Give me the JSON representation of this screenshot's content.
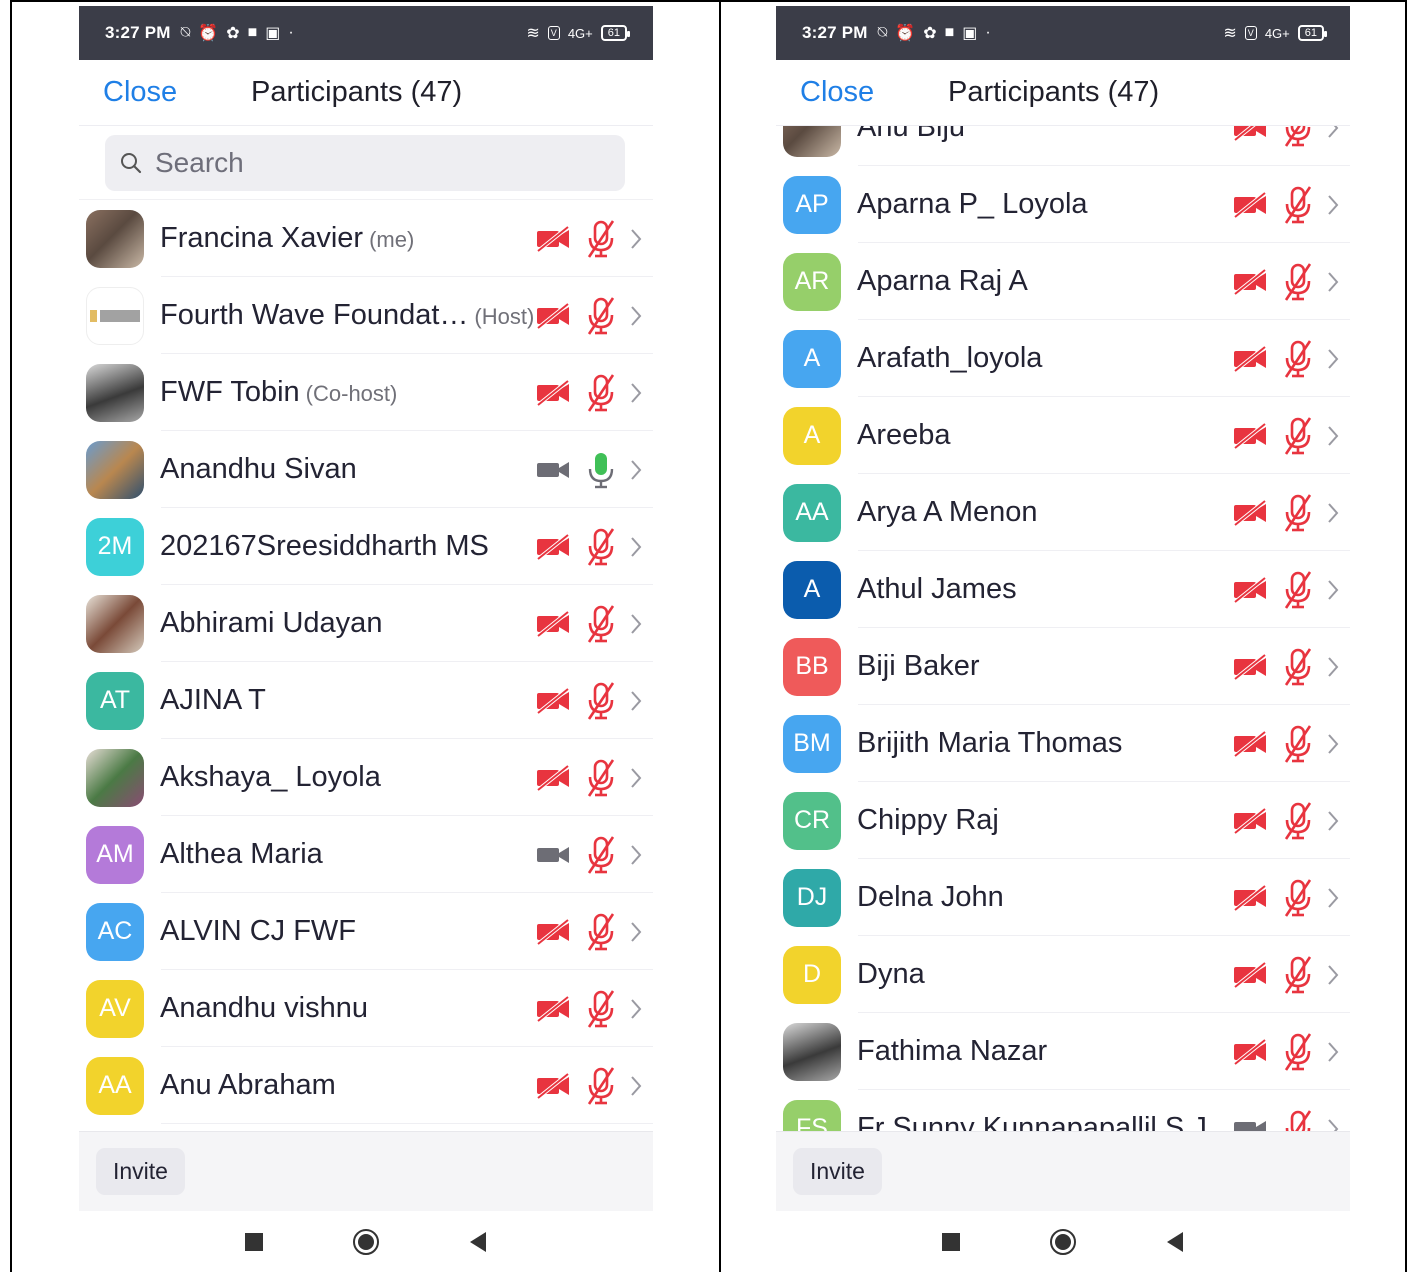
{
  "status_bar": {
    "time": "3:27 PM",
    "battery": "61",
    "network": "4G+"
  },
  "colors": {
    "accent_blue": "#1f7fe6",
    "muted_red": "#e8343f",
    "unmuted_green": "#40c057",
    "status_bar_bg": "#3b3d48"
  },
  "header": {
    "close_label": "Close",
    "title": "Participants (47)"
  },
  "search": {
    "placeholder": "Search"
  },
  "footer": {
    "invite_label": "Invite"
  },
  "screen_left": {
    "participants": [
      {
        "name": "Francina Xavier",
        "role": "(me)",
        "avatar": "photo",
        "video": "off",
        "audio": "muted"
      },
      {
        "name": "Fourth Wave Foundat…",
        "role": "(Host)",
        "avatar": "logo",
        "video": "off",
        "audio": "muted"
      },
      {
        "name": "FWF Tobin",
        "role": "(Co-host)",
        "avatar": "photo",
        "video": "off",
        "audio": "muted"
      },
      {
        "name": "Anandhu Sivan",
        "role": "",
        "avatar": "photo",
        "video": "on",
        "audio": "unmuted"
      },
      {
        "name": "202167Sreesiddharth MS",
        "role": "",
        "initials": "2M",
        "avatar_color": "#3dd0d8",
        "video": "off",
        "audio": "muted"
      },
      {
        "name": "Abhirami Udayan",
        "role": "",
        "avatar": "photo",
        "video": "off",
        "audio": "muted"
      },
      {
        "name": "AJINA T",
        "role": "",
        "initials": "AT",
        "avatar_color": "#3bb8a0",
        "video": "off",
        "audio": "muted"
      },
      {
        "name": "Akshaya_ Loyola",
        "role": "",
        "avatar": "photo",
        "video": "off",
        "audio": "muted"
      },
      {
        "name": "Althea Maria",
        "role": "",
        "initials": "AM",
        "avatar_color": "#b47ad9",
        "video": "on",
        "audio": "muted"
      },
      {
        "name": "ALVIN CJ FWF",
        "role": "",
        "initials": "AC",
        "avatar_color": "#47a6f0",
        "video": "off",
        "audio": "muted"
      },
      {
        "name": "Anandhu vishnu",
        "role": "",
        "initials": "AV",
        "avatar_color": "#f2d32c",
        "video": "off",
        "audio": "muted"
      },
      {
        "name": "Anu Abraham",
        "role": "",
        "initials": "AA",
        "avatar_color": "#f2d32c",
        "video": "off",
        "audio": "muted"
      }
    ]
  },
  "screen_right": {
    "participants": [
      {
        "name": "Anu Biju",
        "role": "",
        "avatar": "photo",
        "video": "off",
        "audio": "muted"
      },
      {
        "name": "Aparna P_ Loyola",
        "role": "",
        "initials": "AP",
        "avatar_color": "#47a6f0",
        "video": "off",
        "audio": "muted"
      },
      {
        "name": "Aparna Raj A",
        "role": "",
        "initials": "AR",
        "avatar_color": "#96cf6a",
        "video": "off",
        "audio": "muted"
      },
      {
        "name": "Arafath_loyola",
        "role": "",
        "initials": "A",
        "avatar_color": "#47a6f0",
        "video": "off",
        "audio": "muted"
      },
      {
        "name": "Areeba",
        "role": "",
        "initials": "A",
        "avatar_color": "#f2d32c",
        "video": "off",
        "audio": "muted"
      },
      {
        "name": "Arya A Menon",
        "role": "",
        "initials": "AA",
        "avatar_color": "#3bb8a0",
        "video": "off",
        "audio": "muted"
      },
      {
        "name": "Athul James",
        "role": "",
        "initials": "A",
        "avatar_color": "#0b5cad",
        "video": "off",
        "audio": "muted"
      },
      {
        "name": "Biji Baker",
        "role": "",
        "initials": "BB",
        "avatar_color": "#ef5a5a",
        "video": "off",
        "audio": "muted"
      },
      {
        "name": "Brijith Maria Thomas",
        "role": "",
        "initials": "BM",
        "avatar_color": "#47a6f0",
        "video": "off",
        "audio": "muted"
      },
      {
        "name": "Chippy Raj",
        "role": "",
        "initials": "CR",
        "avatar_color": "#52c08a",
        "video": "off",
        "audio": "muted"
      },
      {
        "name": "Delna John",
        "role": "",
        "initials": "DJ",
        "avatar_color": "#2fa9a8",
        "video": "off",
        "audio": "muted"
      },
      {
        "name": "Dyna",
        "role": "",
        "initials": "D",
        "avatar_color": "#f2d32c",
        "video": "off",
        "audio": "muted"
      },
      {
        "name": "Fathima Nazar",
        "role": "",
        "avatar": "photo",
        "video": "off",
        "audio": "muted"
      },
      {
        "name": "Fr Sunny Kunnapapallil S.J",
        "role": "",
        "initials": "FS",
        "avatar_color": "#96cf6a",
        "video": "on",
        "audio": "muted"
      }
    ]
  },
  "icons": {
    "search": "search-icon",
    "video_off": "video-off-icon",
    "video_on": "video-on-icon",
    "mic_muted": "mic-muted-icon",
    "mic_on": "mic-on-icon",
    "chevron": "chevron-right-icon",
    "nav_recents": "square-recents-icon",
    "nav_home": "circle-home-icon",
    "nav_back": "triangle-back-icon"
  }
}
